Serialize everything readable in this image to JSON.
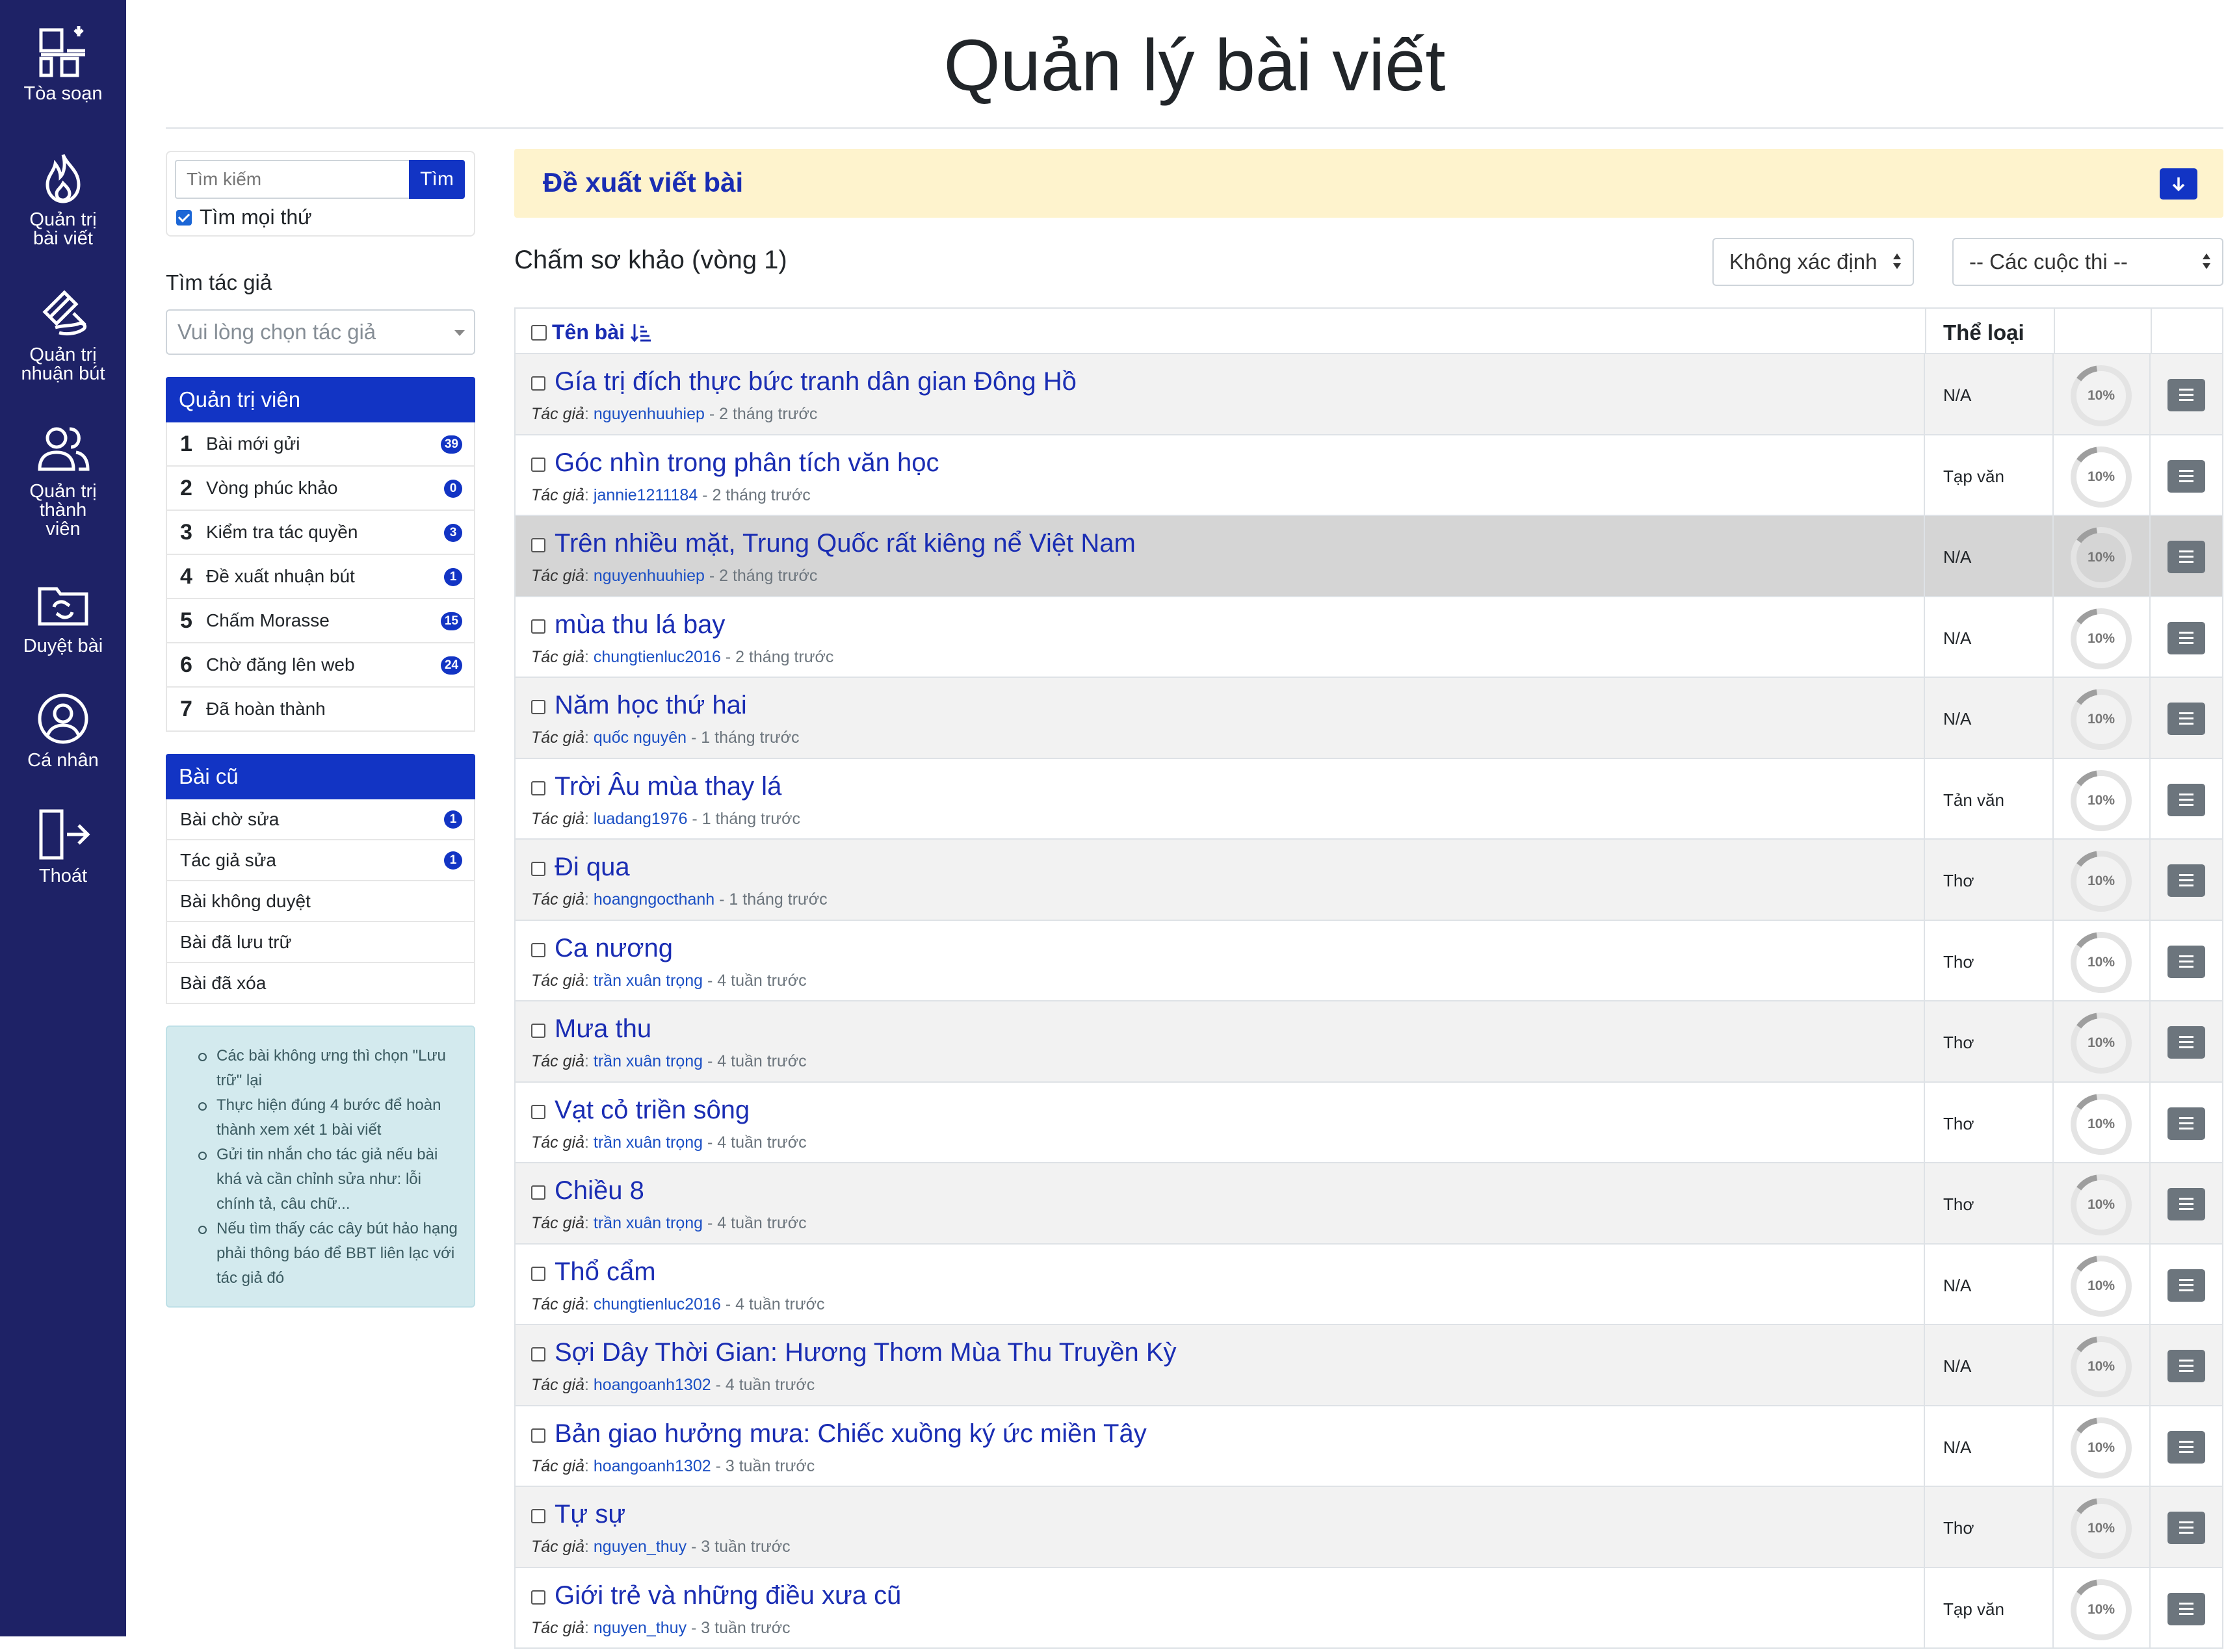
{
  "nav": [
    {
      "label1": "Tòa soạn",
      "label2": "",
      "label3": "",
      "icon": "newsroom-icon"
    },
    {
      "label1": "Quản trị",
      "label2": "bài viết",
      "label3": "",
      "icon": "flame-icon"
    },
    {
      "label1": "Quản trị",
      "label2": "nhuận bút",
      "label3": "",
      "icon": "hand-pen-icon"
    },
    {
      "label1": "Quản trị",
      "label2": "thành",
      "label3": "viên",
      "icon": "users-icon"
    },
    {
      "label1": "Duyệt bài",
      "label2": "",
      "label3": "",
      "icon": "folder-sync-icon"
    },
    {
      "label1": "Cá nhân",
      "label2": "",
      "label3": "",
      "icon": "user-circle-icon"
    },
    {
      "label1": "Thoát",
      "label2": "",
      "label3": "",
      "icon": "logout-icon"
    }
  ],
  "page": {
    "title": "Quản lý bài viết"
  },
  "search": {
    "placeholder": "Tìm kiếm",
    "button": "Tìm",
    "all_label": "Tìm mọi thứ",
    "all_checked": true
  },
  "author": {
    "label": "Tìm tác giả",
    "placeholder": "Vui lòng chọn tác giả"
  },
  "admin_panel": {
    "title": "Quản trị viên",
    "items": [
      {
        "num": "1",
        "label": "Bài mới gửi",
        "badge": "39"
      },
      {
        "num": "2",
        "label": "Vòng phúc khảo",
        "badge": "0"
      },
      {
        "num": "3",
        "label": "Kiểm tra tác quyền",
        "badge": "3"
      },
      {
        "num": "4",
        "label": "Đề xuất nhuận bút",
        "badge": "1"
      },
      {
        "num": "5",
        "label": "Chấm Morasse",
        "badge": "15"
      },
      {
        "num": "6",
        "label": "Chờ đăng lên web",
        "badge": "24"
      },
      {
        "num": "7",
        "label": "Đã hoàn thành",
        "badge": ""
      }
    ]
  },
  "old_panel": {
    "title": "Bài cũ",
    "items": [
      {
        "label": "Bài chờ sửa",
        "badge": "1"
      },
      {
        "label": "Tác giả sửa",
        "badge": "1"
      },
      {
        "label": "Bài không duyệt",
        "badge": ""
      },
      {
        "label": "Bài đã lưu trữ",
        "badge": ""
      },
      {
        "label": "Bài đã xóa",
        "badge": ""
      }
    ]
  },
  "info": [
    "Các bài không ưng thì chọn \"Lưu trữ\" lại",
    "Thực hiện đúng 4 bước để hoàn thành xem xét 1 bài viết",
    "Gửi tin nhắn cho tác giả nếu bài khá và cần chỉnh sửa như: lỗi chính tả, câu chữ...",
    "Nếu tìm thấy các cây bút hảo hạng phải thông báo để BBT liên lạc với tác giả đó"
  ],
  "proposal": {
    "title": "Đề xuất viết bài",
    "button_icon": "arrow-down-icon"
  },
  "round": {
    "title": "Chấm sơ khảo (vòng 1)"
  },
  "filters": {
    "status": "Không xác định",
    "contest": "-- Các cuộc thi --"
  },
  "table": {
    "col_title": "Tên bài",
    "col_category": "Thể loại",
    "author_prefix": "Tác giả",
    "rows": [
      {
        "title": "Gía trị đích thực bức tranh dân gian Đông Hồ",
        "author": "nguyenhuuhiep",
        "time": "2 tháng trước",
        "category": "N/A",
        "progress": "10%"
      },
      {
        "title": "Góc nhìn trong phân tích văn học",
        "author": "jannie1211184",
        "time": "2 tháng trước",
        "category": "Tạp văn",
        "progress": "10%"
      },
      {
        "title": "Trên nhiều mặt, Trung Quốc rất kiêng nể Việt Nam",
        "author": "nguyenhuuhiep",
        "time": "2 tháng trước",
        "category": "N/A",
        "progress": "10%"
      },
      {
        "title": "mùa thu lá bay",
        "author": "chungtienluc2016",
        "time": "2 tháng trước",
        "category": "N/A",
        "progress": "10%"
      },
      {
        "title": "Năm học thứ hai",
        "author": "quốc nguyên",
        "time": "1 tháng trước",
        "category": "N/A",
        "progress": "10%"
      },
      {
        "title": "Trời Âu mùa thay lá",
        "author": "luadang1976",
        "time": "1 tháng trước",
        "category": "Tản văn",
        "progress": "10%"
      },
      {
        "title": "Đi qua",
        "author": "hoangngocthanh",
        "time": "1 tháng trước",
        "category": "Thơ",
        "progress": "10%"
      },
      {
        "title": "Ca nương",
        "author": "trần xuân trọng",
        "time": "4 tuần trước",
        "category": "Thơ",
        "progress": "10%"
      },
      {
        "title": "Mưa thu",
        "author": "trần xuân trọng",
        "time": "4 tuần trước",
        "category": "Thơ",
        "progress": "10%"
      },
      {
        "title": "Vạt cỏ triền sông",
        "author": "trần xuân trọng",
        "time": "4 tuần trước",
        "category": "Thơ",
        "progress": "10%"
      },
      {
        "title": "Chiều 8",
        "author": "trần xuân trọng",
        "time": "4 tuần trước",
        "category": "Thơ",
        "progress": "10%"
      },
      {
        "title": "Thổ cẩm",
        "author": "chungtienluc2016",
        "time": "4 tuần trước",
        "category": "N/A",
        "progress": "10%"
      },
      {
        "title": "Sợi Dây Thời Gian: Hương Thơm Mùa Thu Truyền Kỳ",
        "author": "hoangoanh1302",
        "time": "4 tuần trước",
        "category": "N/A",
        "progress": "10%"
      },
      {
        "title": "Bản giao hưởng mưa: Chiếc xuồng ký ức miền Tây",
        "author": "hoangoanh1302",
        "time": "3 tuần trước",
        "category": "N/A",
        "progress": "10%"
      },
      {
        "title": "Tự sự",
        "author": "nguyen_thuy",
        "time": "3 tuần trước",
        "category": "Thơ",
        "progress": "10%"
      },
      {
        "title": "Giới trẻ và những điều xưa cũ",
        "author": "nguyen_thuy",
        "time": "3 tuần trước",
        "category": "Tạp văn",
        "progress": "10%"
      }
    ]
  }
}
